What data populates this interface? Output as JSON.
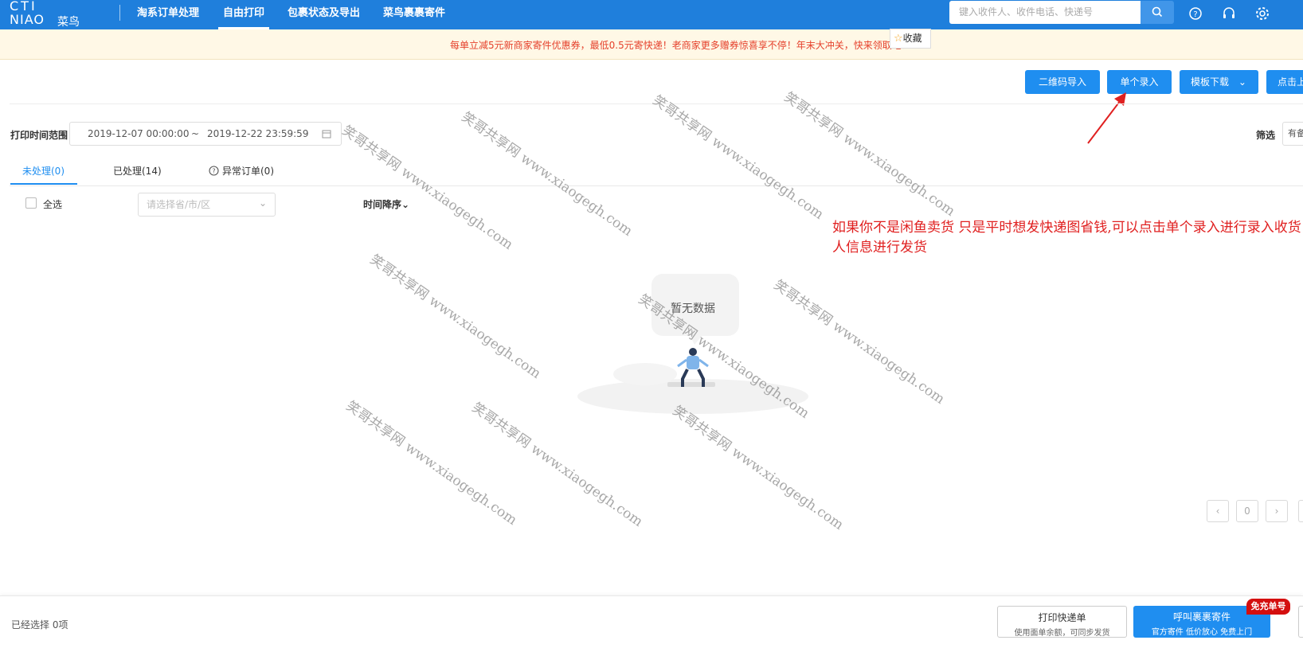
{
  "header": {
    "logo_line1": "CTI",
    "logo_line2": "NIAO",
    "logo_cn": "菜鸟",
    "nav": [
      "淘系订单处理",
      "自由打印",
      "包裹状态及导出",
      "菜鸟裹裹寄件"
    ],
    "search_placeholder": "键入收件人、收件电话、快递号"
  },
  "promo": {
    "text": "每单立减5元新商家寄件优惠券，最低0.5元寄快递！老商家更多赠券惊喜享不停！年末大冲关，快来领取吧！",
    "favorite_label": "收藏"
  },
  "toolbar": {
    "qr_import": "二维码导入",
    "single_entry": "单个录入",
    "template_download": "模板下载",
    "click_upload": "点击上"
  },
  "filters": {
    "print_time_label": "打印时间范围",
    "date_start": "2019-12-07 00:00:00",
    "date_sep": "~",
    "date_end": "2019-12-22 23:59:59",
    "screen_label": "筛选",
    "screen_value": "有备"
  },
  "tabs": {
    "unprocessed": "未处理(0)",
    "processed": "已处理(14)",
    "abnormal": "异常订单(0)"
  },
  "list": {
    "select_all": "全选",
    "region_placeholder": "请选择省/市/区",
    "sort_label": "时间降序",
    "empty": "暂无数据"
  },
  "annotation": "如果你不是闲鱼卖货 只是平时想发快递图省钱,可以点击单个录入进行录入收货人信息进行发货",
  "watermark": "笑哥共享网 www.xiaogegh.com",
  "pager": {
    "current": "0"
  },
  "footer": {
    "selected": "已经选择 0项",
    "print_title": "打印快递单",
    "print_sub": "使用面单余额，可同步发货",
    "call_title": "呼叫裹裹寄件",
    "call_sub": "官方寄件 低价放心 免费上门",
    "badge": "免充单号"
  },
  "colors": {
    "brand": "#1f7fdc",
    "primary": "#1f8ef0",
    "promo_text": "#e5402b",
    "annotation": "#e02020"
  }
}
